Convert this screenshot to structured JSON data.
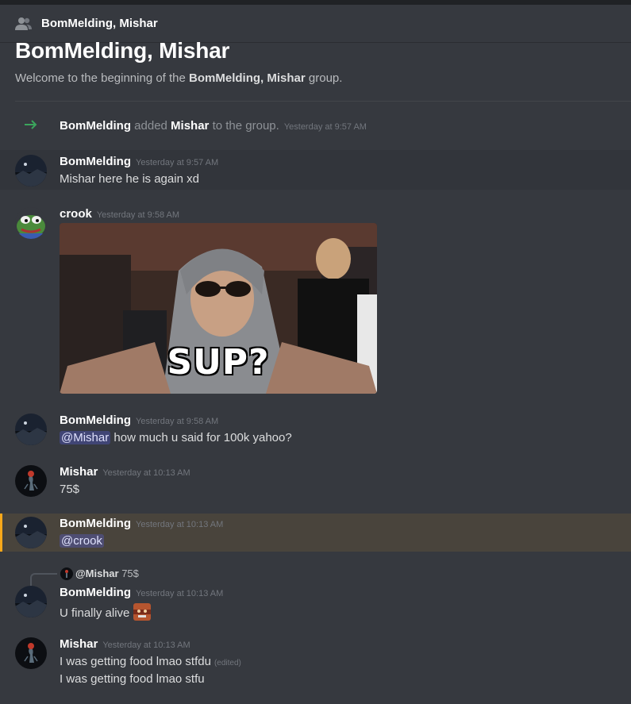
{
  "header": {
    "title": "BomMelding, Mishar",
    "icon": "group-dm-icon"
  },
  "welcome": {
    "title": "BomMelding, Mishar",
    "pre": "Welcome to the beginning of the ",
    "group_name": "BomMelding, Mishar",
    "post": " group."
  },
  "system": {
    "actor": "BomMelding",
    "verb": " added ",
    "target": "Mishar",
    "tail": " to the group.",
    "timestamp": "Yesterday at 9:57 AM",
    "icon": "join-arrow-icon"
  },
  "messages": [
    {
      "author": "BomMelding",
      "timestamp": "Yesterday at 9:57 AM",
      "text": "Mishar here he is again xd"
    },
    {
      "author": "crook",
      "timestamp": "Yesterday at 9:58 AM",
      "gif_caption": "SUP?"
    },
    {
      "author": "BomMelding",
      "timestamp": "Yesterday at 9:58 AM",
      "mention": "@Mishar",
      "text": " how much u said for 100k yahoo?"
    },
    {
      "author": "Mishar",
      "timestamp": "Yesterday at 10:13 AM",
      "text": "75$"
    },
    {
      "author": "BomMelding",
      "timestamp": "Yesterday at 10:13 AM",
      "mention": "@crook"
    },
    {
      "author": "BomMelding",
      "timestamp": "Yesterday at 10:13 AM",
      "reply_to": {
        "author": "@Mishar",
        "text": " 75$"
      },
      "text": "U finally alive ",
      "emoji": "face-emoji"
    },
    {
      "author": "Mishar",
      "timestamp": "Yesterday at 10:13 AM",
      "text": "I was getting food lmao stfdu",
      "edited": "(edited)",
      "text2": "I was getting food lmao stfu"
    }
  ],
  "colors": {
    "accent": "#5865f2",
    "highlight": "#faa81a",
    "online": "#3ba55c"
  }
}
